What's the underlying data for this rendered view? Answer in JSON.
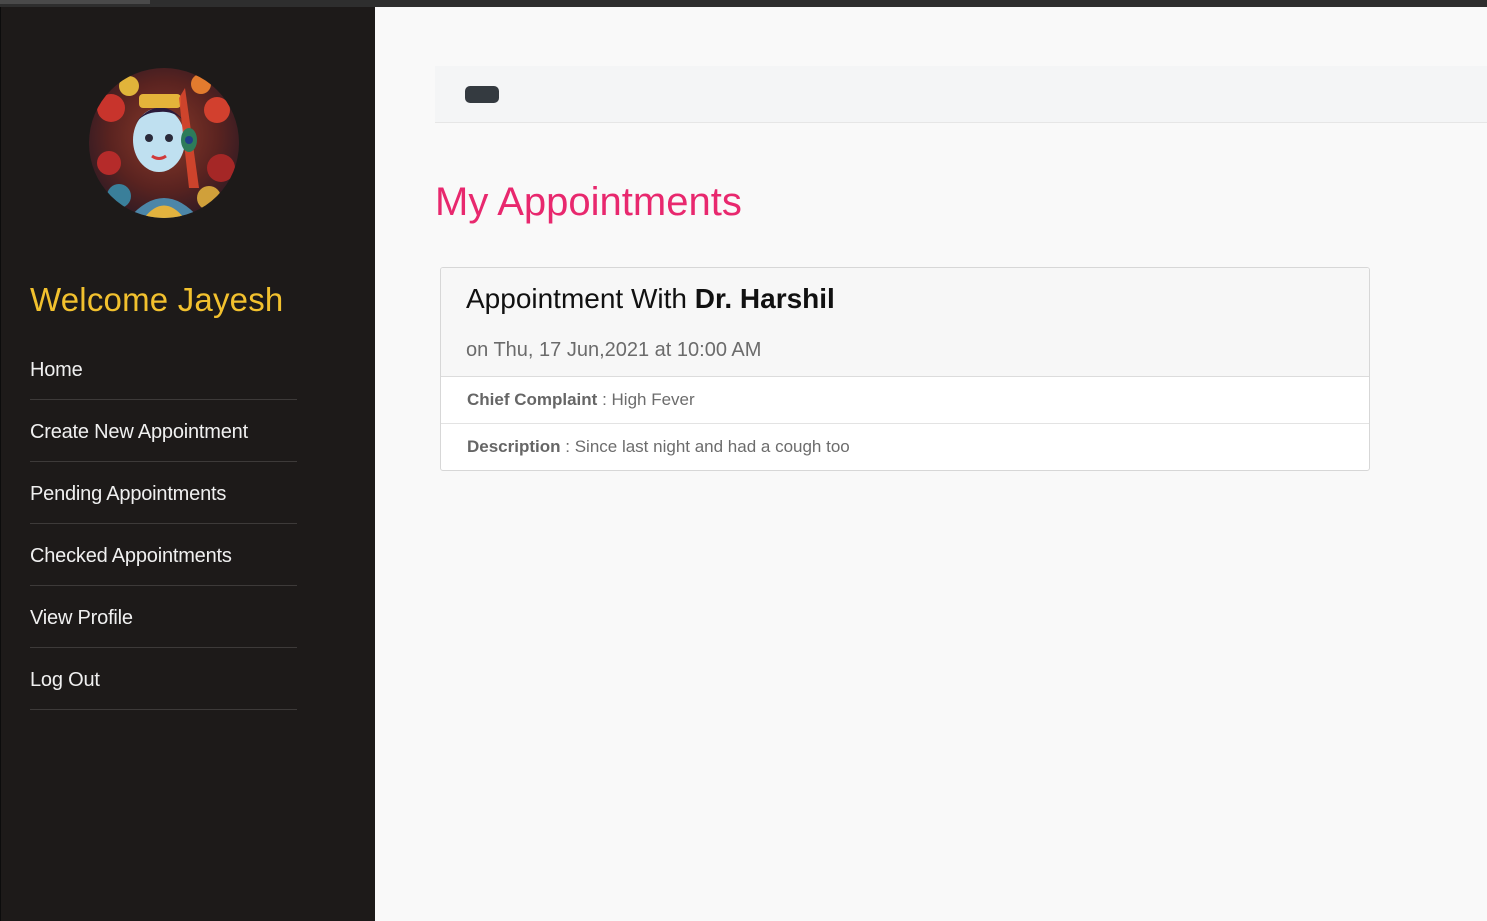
{
  "sidebar": {
    "welcome": "Welcome Jayesh",
    "items": [
      {
        "label": "Home"
      },
      {
        "label": "Create New Appointment"
      },
      {
        "label": "Pending Appointments"
      },
      {
        "label": "Checked Appointments"
      },
      {
        "label": "View Profile"
      },
      {
        "label": "Log Out"
      }
    ]
  },
  "main": {
    "title": "My Appointments",
    "appointment": {
      "title_prefix": "Appointment With ",
      "doctor": "Dr. Harshil",
      "datetime": "on Thu, 17 Jun,2021 at 10:00 AM",
      "complaint_label": "Chief Complaint",
      "complaint_value": "High Fever",
      "description_label": "Description",
      "description_value": "Since last night and had a cough too",
      "separator": " : "
    }
  },
  "colors": {
    "sidebar_bg": "#1d1a19",
    "welcome": "#f2c12e",
    "title": "#e8286e",
    "toggle": "#343a40"
  },
  "icons": {
    "navbar_toggle": "menu-toggle-icon"
  }
}
